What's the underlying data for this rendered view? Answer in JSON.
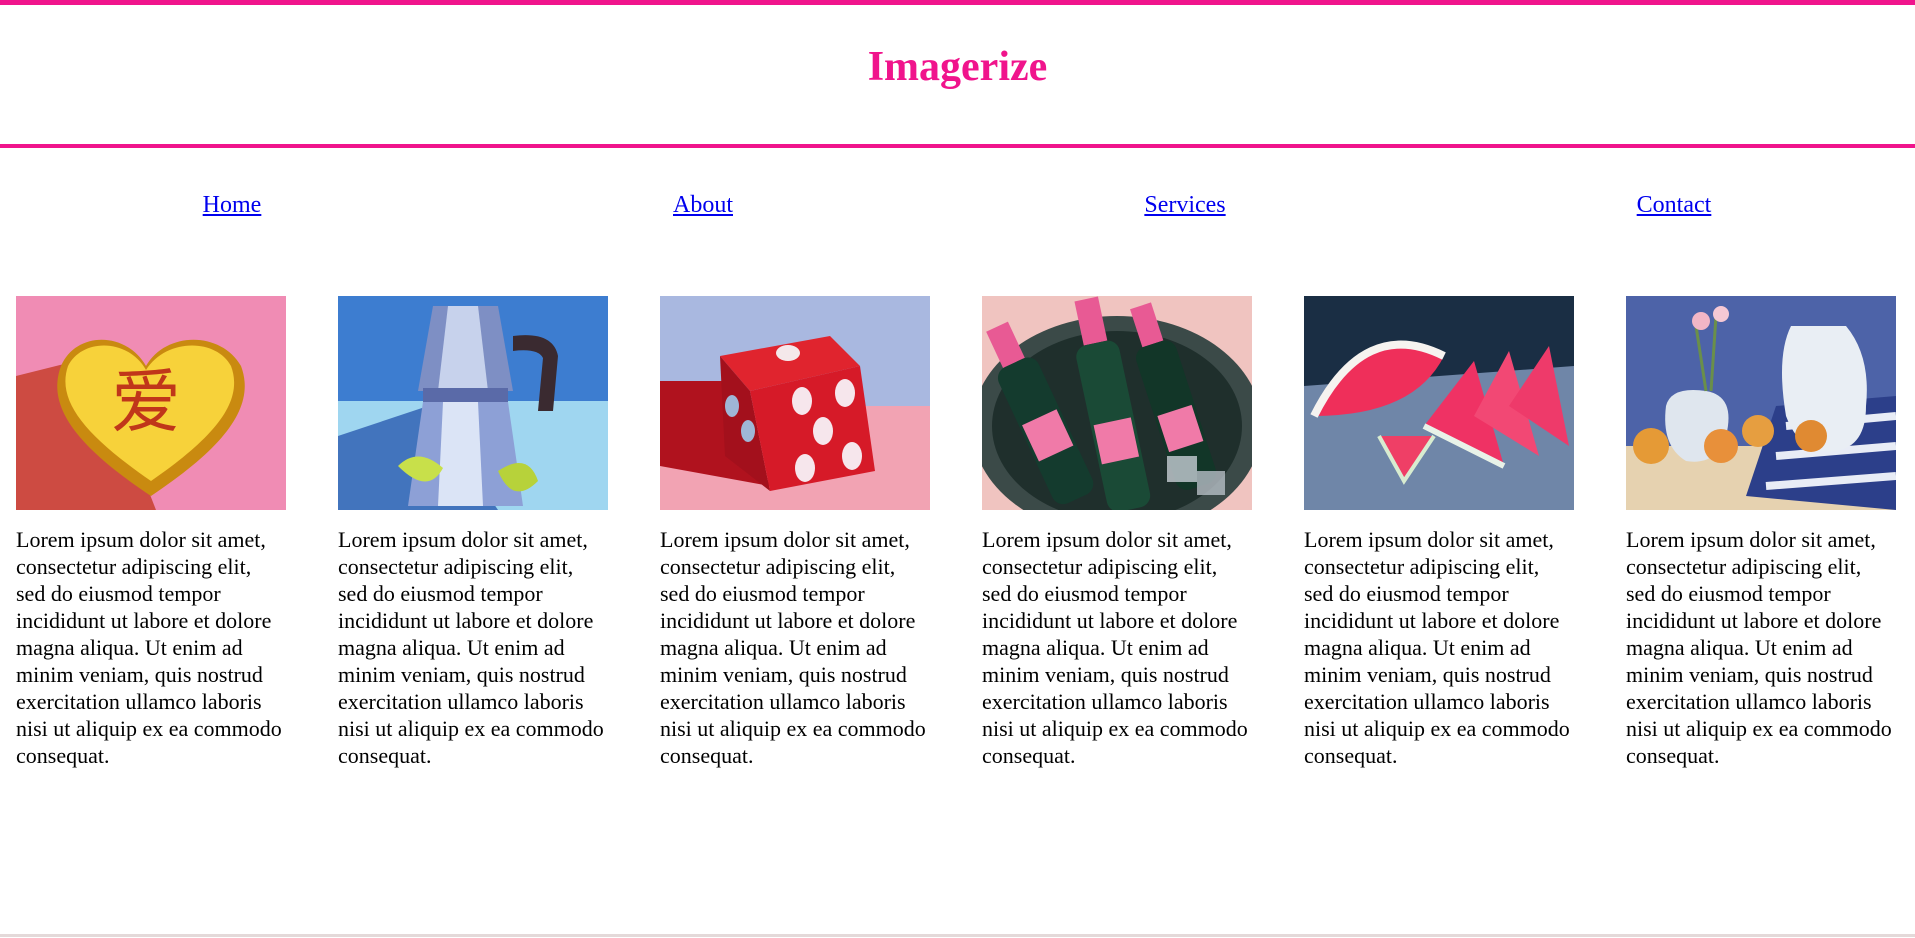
{
  "site": {
    "title": "Imagerize",
    "accent_color": "#f0148c",
    "link_color": "#0000ee"
  },
  "nav": {
    "items": [
      {
        "label": "Home"
      },
      {
        "label": "About"
      },
      {
        "label": "Services"
      },
      {
        "label": "Contact"
      }
    ]
  },
  "gallery": {
    "cards": [
      {
        "image": "candy-heart-painting",
        "text": "Lorem ipsum dolor sit amet, consectetur adipiscing elit, sed do eiusmod tempor incididunt ut labore et dolore magna aliqua. Ut enim ad minim veniam, quis nostrud exercitation ullamco laboris nisi ut aliquip ex ea commodo consequat."
      },
      {
        "image": "moka-pot-painting",
        "text": "Lorem ipsum dolor sit amet, consectetur adipiscing elit, sed do eiusmod tempor incididunt ut labore et dolore magna aliqua. Ut enim ad minim veniam, quis nostrud exercitation ullamco laboris nisi ut aliquip ex ea commodo consequat."
      },
      {
        "image": "red-die-painting",
        "text": "Lorem ipsum dolor sit amet, consectetur adipiscing elit, sed do eiusmod tempor incididunt ut labore et dolore magna aliqua. Ut enim ad minim veniam, quis nostrud exercitation ullamco laboris nisi ut aliquip ex ea commodo consequat."
      },
      {
        "image": "champagne-bottles-painting",
        "text": "Lorem ipsum dolor sit amet, consectetur adipiscing elit, sed do eiusmod tempor incididunt ut labore et dolore magna aliqua. Ut enim ad minim veniam, quis nostrud exercitation ullamco laboris nisi ut aliquip ex ea commodo consequat."
      },
      {
        "image": "watermelon-slices-painting",
        "text": "Lorem ipsum dolor sit amet, consectetur adipiscing elit, sed do eiusmod tempor incididunt ut labore et dolore magna aliqua. Ut enim ad minim veniam, quis nostrud exercitation ullamco laboris nisi ut aliquip ex ea commodo consequat."
      },
      {
        "image": "still-life-peaches-painting",
        "text": "Lorem ipsum dolor sit amet, consectetur adipiscing elit, sed do eiusmod tempor incididunt ut labore et dolore magna aliqua. Ut enim ad minim veniam, quis nostrud exercitation ullamco laboris nisi ut aliquip ex ea commodo consequat."
      }
    ]
  }
}
